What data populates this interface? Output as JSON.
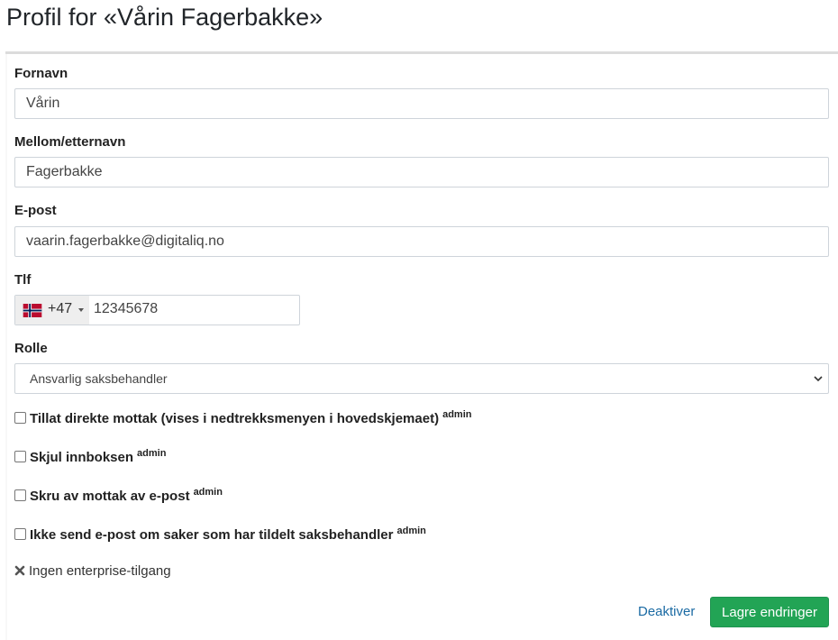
{
  "page": {
    "title": "Profil for «Vårin Fagerbakke»"
  },
  "form": {
    "first_name": {
      "label": "Fornavn",
      "value": "Vårin"
    },
    "last_name": {
      "label": "Mellom/etternavn",
      "value": "Fagerbakke"
    },
    "email": {
      "label": "E-post",
      "value": "vaarin.fagerbakke@digitaliq.no"
    },
    "phone": {
      "label": "Tlf",
      "country_flag": "norway-flag-icon",
      "dial_code": "+47",
      "number": "12345678"
    },
    "role": {
      "label": "Rolle",
      "selected": "Ansvarlig saksbehandler"
    },
    "checkboxes": [
      {
        "label": "Tillat direkte mottak (vises i nedtrekksmenyen i hovedskjemaet)",
        "badge": "admin",
        "checked": false
      },
      {
        "label": "Skjul innboksen",
        "badge": "admin",
        "checked": false
      },
      {
        "label": "Skru av mottak av e-post",
        "badge": "admin",
        "checked": false
      },
      {
        "label": "Ikke send e-post om saker som har tildelt saksbehandler",
        "badge": "admin",
        "checked": false
      }
    ],
    "enterprise_status": "Ingen enterprise-tilgang"
  },
  "actions": {
    "deactivate_label": "Deaktiver",
    "save_label": "Lagre endringer"
  },
  "colors": {
    "save_button": "#22a455",
    "link": "#1a6aa3"
  }
}
